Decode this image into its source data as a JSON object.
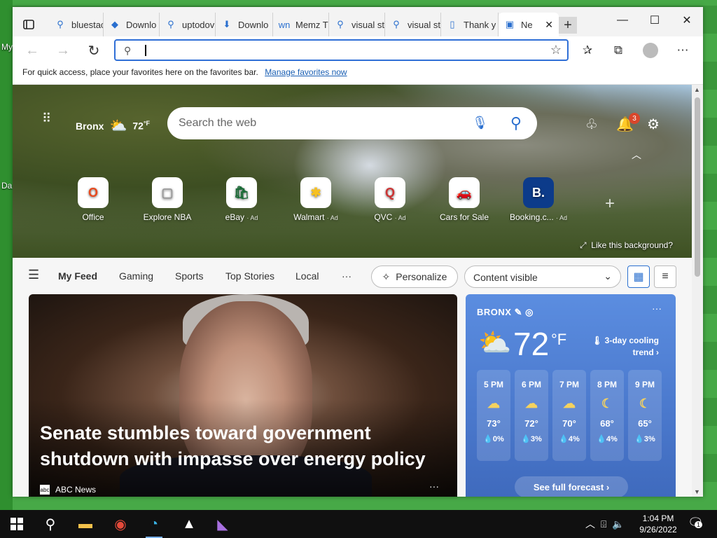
{
  "desktop": {
    "icon_labels": [
      "My",
      "Da"
    ]
  },
  "tabs": [
    {
      "label": "bluestac",
      "icon": "search-icon"
    },
    {
      "label": "Downlo",
      "icon": "bluestacks-icon"
    },
    {
      "label": "uptodov",
      "icon": "search-icon"
    },
    {
      "label": "Downlo",
      "icon": "download-icon"
    },
    {
      "label": "Memz T",
      "icon": "wn-icon"
    },
    {
      "label": "visual st",
      "icon": "search-icon"
    },
    {
      "label": "visual st",
      "icon": "search-icon"
    },
    {
      "label": "Thank y",
      "icon": "page-icon"
    },
    {
      "label": "Ne",
      "icon": "newtab-icon",
      "active": true
    }
  ],
  "address": {
    "placeholder": "",
    "value": ""
  },
  "favorites_bar": {
    "text": "For quick access, place your favorites here on the favorites bar.",
    "link": "Manage favorites now"
  },
  "hero": {
    "location": "Bronx",
    "temp": "72",
    "unit": "°F",
    "search_placeholder": "Search the web",
    "notification_count": "3",
    "like_background": "Like this background?"
  },
  "quick_links": [
    {
      "label": "Office",
      "ad": "",
      "glyph": "O",
      "color": "#e8491d"
    },
    {
      "label": "Explore NBA",
      "ad": "",
      "glyph": "▢",
      "color": "#999999"
    },
    {
      "label": "eBay",
      "ad": "· Ad",
      "glyph": "🛍",
      "color": "#1a6b36"
    },
    {
      "label": "Walmart",
      "ad": "· Ad",
      "glyph": "✱",
      "color": "#f7c120"
    },
    {
      "label": "QVC",
      "ad": "· Ad",
      "glyph": "Q",
      "color": "#cc3333"
    },
    {
      "label": "Cars for Sale",
      "ad": "",
      "glyph": "🚗",
      "color": "#2a6fcf"
    },
    {
      "label": "Booking.c...",
      "ad": "· Ad",
      "glyph": "B.",
      "color": "#ffffff"
    }
  ],
  "feed_nav": {
    "items": [
      "My Feed",
      "Gaming",
      "Sports",
      "Top Stories",
      "Local",
      "···"
    ],
    "personalize": "Personalize",
    "content_visible": "Content visible"
  },
  "news": {
    "headline": "Senate stumbles toward government shutdown with impasse over energy policy",
    "source": "ABC News",
    "more": "···"
  },
  "weather": {
    "city": "BRONX",
    "more": "···",
    "temp": "72",
    "unit": "°F",
    "trend": "3-day cooling trend",
    "hours": [
      {
        "time": "5 PM",
        "icon": "☁",
        "temp": "73°",
        "precip": "0%"
      },
      {
        "time": "6 PM",
        "icon": "☁",
        "temp": "72°",
        "precip": "3%"
      },
      {
        "time": "7 PM",
        "icon": "☁",
        "temp": "70°",
        "precip": "4%"
      },
      {
        "time": "8 PM",
        "icon": "☾",
        "temp": "68°",
        "precip": "4%"
      },
      {
        "time": "9 PM",
        "icon": "☾",
        "temp": "65°",
        "precip": "3%"
      }
    ],
    "full_forecast": "See full forecast ›"
  },
  "taskbar": {
    "time": "1:04 PM",
    "date": "9/26/2022",
    "notifications": "1"
  }
}
